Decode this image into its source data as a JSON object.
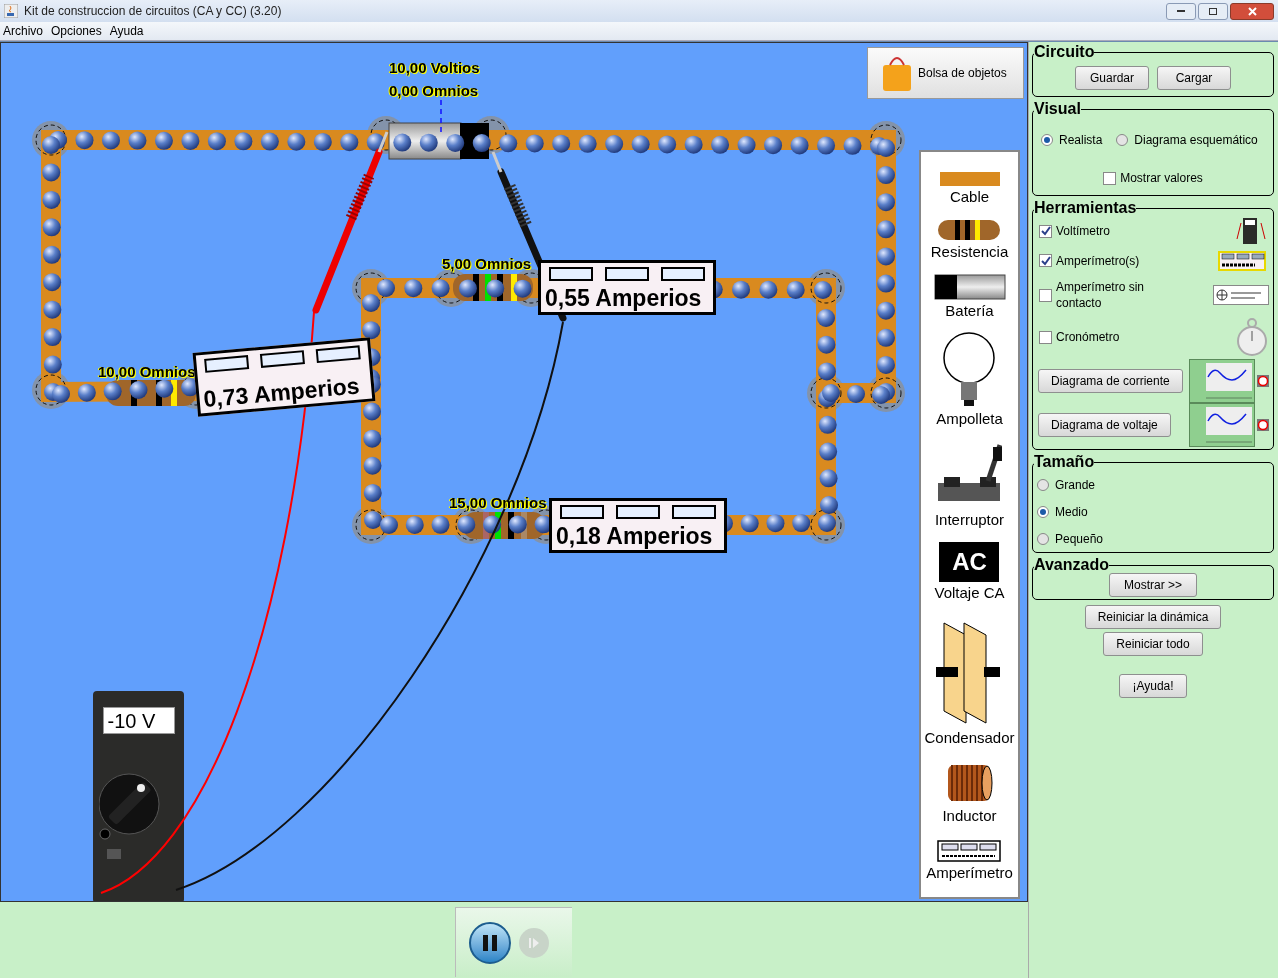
{
  "window": {
    "title": "Kit de construccion de circuitos (CA y CC) (3.20)"
  },
  "menu": [
    "Archivo",
    "Opciones",
    "Ayuda"
  ],
  "canvas": {
    "object_bag": "Bolsa de objetos",
    "labels": [
      {
        "text": "10,00 Voltios"
      },
      {
        "text": "0,00 Omnios"
      },
      {
        "text": "10,00 Omnios"
      },
      {
        "text": "5,00 Omnios"
      },
      {
        "text": "15,00 Omnios"
      }
    ],
    "ammeters": [
      {
        "reading": "0,73 Amperios"
      },
      {
        "reading": "0,55 Amperios"
      },
      {
        "reading": "0,18 Amperios"
      }
    ],
    "voltmeter": {
      "reading": "-10 V"
    }
  },
  "toolbox": [
    {
      "kind": "wire",
      "label": "Cable"
    },
    {
      "kind": "resistor",
      "label": "Resistencia"
    },
    {
      "kind": "battery",
      "label": "Batería"
    },
    {
      "kind": "bulb",
      "label": "Ampolleta"
    },
    {
      "kind": "switch",
      "label": "Interruptor"
    },
    {
      "kind": "ac",
      "label": "Voltaje CA",
      "icon_text": "AC"
    },
    {
      "kind": "capacitor",
      "label": "Condensador"
    },
    {
      "kind": "inductor",
      "label": "Inductor"
    },
    {
      "kind": "ammeter",
      "label": "Amperímetro"
    }
  ],
  "playback": {
    "running": true,
    "step_enabled": false
  },
  "panel": {
    "circuit": {
      "title": "Circuito",
      "buttons": [
        "Guardar",
        "Cargar"
      ]
    },
    "visual": {
      "title": "Visual",
      "options": [
        {
          "label": "Realista",
          "selected": true
        },
        {
          "label": "Diagrama esquemático",
          "selected": false
        }
      ],
      "show_values": {
        "label": "Mostrar valores",
        "checked": false
      }
    },
    "tools": {
      "title": "Herramientas",
      "items": [
        {
          "label": "Voltímetro",
          "checked": true
        },
        {
          "label": "Amperímetro(s)",
          "checked": true
        },
        {
          "label": "Amperímetro sin contacto",
          "checked": false
        },
        {
          "label": "Cronómetro",
          "checked": false
        }
      ],
      "chart_buttons": [
        "Diagrama de corriente",
        "Diagrama de voltaje"
      ]
    },
    "size": {
      "title": "Tamaño",
      "options": [
        {
          "label": "Grande",
          "selected": false
        },
        {
          "label": "Medio",
          "selected": true
        },
        {
          "label": "Pequeño",
          "selected": false
        }
      ]
    },
    "advanced": {
      "title": "Avanzado",
      "button": "Mostrar >>"
    },
    "buttons": [
      "Reiniciar la dinámica",
      "Reiniciar todo",
      "¡Ayuda!"
    ]
  }
}
